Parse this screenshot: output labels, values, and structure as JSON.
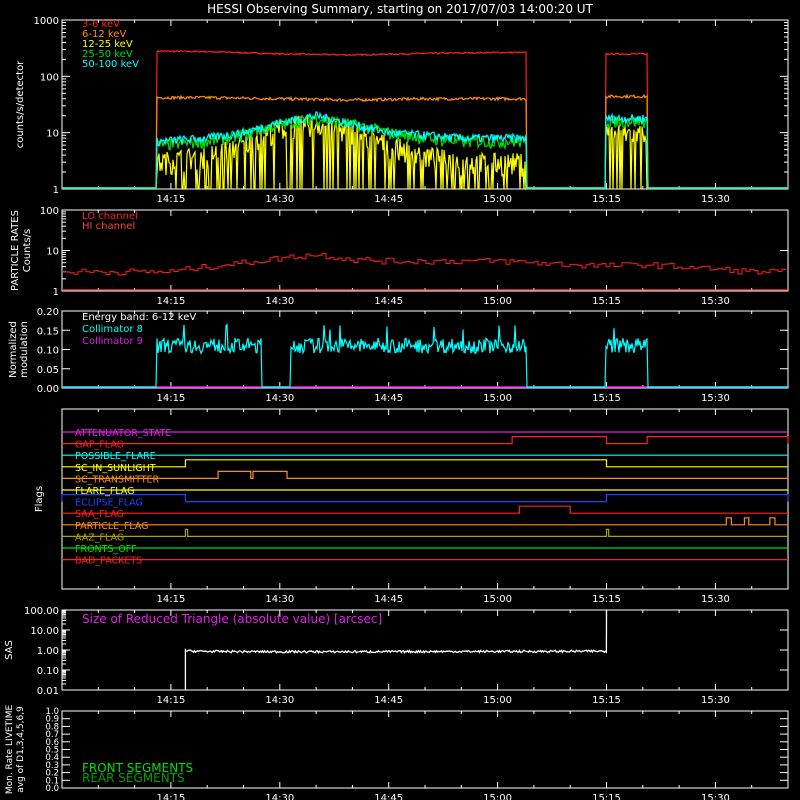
{
  "title": "HESSI Observing Summary, starting on 2017/07/03 14:00:20 UT",
  "time_axis": {
    "ticks": [
      "14:15",
      "14:30",
      "14:45",
      "15:00",
      "15:15",
      "15:30"
    ],
    "tick_minutes": [
      15,
      30,
      45,
      60,
      75,
      90
    ]
  },
  "colors": {
    "red": "#ff2020",
    "orange": "#ff8c1a",
    "yellow": "#ffff00",
    "green": "#00e000",
    "cyan": "#00ffff",
    "magenta": "#e020e0",
    "blue": "#2040ff",
    "olive": "#b0a000",
    "darkgreen": "#00a000",
    "salmon": "#ff4040",
    "white": "#ffffff"
  },
  "chart_data": [
    {
      "name": "count-rates",
      "type": "line",
      "ylabel": "counts/s/detector",
      "yscale": "log",
      "ylim": [
        1,
        1000
      ],
      "ytick_labels": [
        "1",
        "10",
        "100",
        "1000"
      ],
      "xlim_minutes": [
        0,
        100
      ],
      "data_intervals_minutes": [
        [
          13.0,
          64.0
        ],
        [
          74.8,
          80.6
        ]
      ],
      "series": [
        {
          "name": "3-6 keV",
          "color": "red",
          "x": [
            13,
            20,
            30,
            40,
            50,
            60,
            64,
            74.8,
            80.6
          ],
          "y": [
            280,
            275,
            250,
            240,
            255,
            265,
            265,
            250,
            250
          ]
        },
        {
          "name": "6-12 keV",
          "color": "orange",
          "x": [
            13,
            20,
            30,
            40,
            50,
            60,
            64,
            74.8,
            80.6
          ],
          "y": [
            42,
            42,
            40,
            38,
            40,
            40,
            40,
            44,
            44
          ]
        },
        {
          "name": "12-25 keV",
          "color": "yellow",
          "x": [
            13,
            20,
            25,
            30,
            35,
            40,
            45,
            50,
            55,
            60,
            64,
            74.8,
            80.6
          ],
          "y": [
            3,
            4,
            6,
            12,
            15,
            10,
            6,
            4,
            3,
            3,
            3,
            10,
            10
          ]
        },
        {
          "name": "25-50 keV",
          "color": "green",
          "x": [
            13,
            20,
            25,
            30,
            35,
            40,
            45,
            50,
            55,
            60,
            64,
            74.8,
            80.6
          ],
          "y": [
            6,
            7,
            9,
            14,
            18,
            14,
            10,
            8,
            7,
            7,
            7,
            16,
            16
          ]
        },
        {
          "name": "50-100 keV",
          "color": "cyan",
          "x": [
            13,
            20,
            25,
            30,
            35,
            40,
            45,
            50,
            55,
            60,
            64,
            74.8,
            80.6
          ],
          "y": [
            7,
            8,
            10,
            15,
            20,
            14,
            10,
            9,
            8,
            8,
            8,
            18,
            18
          ]
        }
      ]
    },
    {
      "name": "particle-rates",
      "type": "line",
      "ylabel": "PARTICLE RATES Counts/s",
      "yscale": "log",
      "ylim": [
        1,
        100
      ],
      "ytick_labels": [
        "1",
        "10",
        "100"
      ],
      "series": [
        {
          "name": "LO channel",
          "color": "red",
          "x": [
            0,
            5,
            10,
            15,
            20,
            25,
            30,
            35,
            40,
            45,
            50,
            55,
            60,
            65,
            70,
            75,
            80,
            85,
            90,
            95,
            100
          ],
          "y": [
            3,
            3,
            3,
            3,
            4,
            5,
            6.5,
            8,
            6,
            5.5,
            5.5,
            5.5,
            5.5,
            5,
            4.5,
            4.2,
            4.5,
            4,
            3.5,
            3,
            3
          ]
        },
        {
          "name": "HI channel",
          "color": "salmon",
          "x": [
            0,
            100
          ],
          "y": [
            1,
            1
          ]
        }
      ]
    },
    {
      "name": "modulation",
      "type": "line",
      "ylabel": "Normalized modulation",
      "ylim": [
        0,
        0.2
      ],
      "ytick_labels": [
        "0.00",
        "0.05",
        "0.10",
        "0.15",
        "0.20"
      ],
      "annotation": "Energy band: 6-12 keV",
      "data_intervals_minutes": [
        [
          13.0,
          27.5
        ],
        [
          31.5,
          64.0
        ],
        [
          74.8,
          80.6
        ]
      ],
      "series": [
        {
          "name": "Collimator 8",
          "color": "cyan",
          "mean": 0.11
        },
        {
          "name": "Collimator 9",
          "color": "magenta",
          "mean": 0.0
        }
      ]
    },
    {
      "name": "flags",
      "type": "line",
      "ylabel": "Flags",
      "series": [
        {
          "name": "ATTENUATOR_STATE",
          "color": "magenta",
          "high": []
        },
        {
          "name": "GAP_FLAG",
          "color": "red",
          "high": [
            [
              62,
              75
            ],
            [
              80.6,
              100
            ]
          ]
        },
        {
          "name": "POSSIBLE_FLARE",
          "color": "cyan",
          "high": []
        },
        {
          "name": "SC_IN_SUNLIGHT",
          "color": "yellow",
          "high": [
            [
              17,
              75
            ]
          ]
        },
        {
          "name": "SC_TRANSMITTER",
          "color": "orange",
          "high": [
            [
              21.5,
              26
            ],
            [
              26.3,
              31
            ]
          ]
        },
        {
          "name": "FLARE_FLAG",
          "color": "yellow",
          "high": []
        },
        {
          "name": "ECLIPSE_FLAG",
          "color": "blue",
          "high": [
            [
              0,
              17
            ],
            [
              75,
              100
            ]
          ]
        },
        {
          "name": "SAA_FLAG",
          "color": "red",
          "high": [
            [
              63,
              70
            ]
          ]
        },
        {
          "name": "PARTICLE_FLAG",
          "color": "orange",
          "high": [
            [
              91.5,
              92.2
            ],
            [
              94,
              94.6
            ],
            [
              97.5,
              98.2
            ]
          ]
        },
        {
          "name": "AAZ_FLAG",
          "color": "olive",
          "high": [
            [
              17,
              17.3
            ],
            [
              75,
              75.3
            ]
          ]
        },
        {
          "name": "FRONTS_OFF",
          "color": "green",
          "high": []
        },
        {
          "name": "BAD_PACKETS",
          "color": "red",
          "high": []
        }
      ]
    },
    {
      "name": "sas",
      "type": "line",
      "ylabel": "SAS",
      "yscale": "log",
      "ylim": [
        0.01,
        100
      ],
      "ytick_labels": [
        "0.01",
        "0.10",
        "1.00",
        "10.00",
        "100.00"
      ],
      "annotation": "Size of Reduced Triangle (absolute value) [arcsec]",
      "data_interval_minutes": [
        17.0,
        75.0
      ],
      "series": [
        {
          "name": "",
          "color": "white",
          "x": [
            17,
            20,
            30,
            40,
            50,
            60,
            70,
            75
          ],
          "y": [
            0.9,
            0.85,
            0.82,
            0.82,
            0.84,
            0.85,
            0.86,
            0.88
          ]
        }
      ]
    },
    {
      "name": "livetime",
      "type": "line",
      "ylabel": "Mon. Rate LIVETIME avg of D1,3,4,5,6,9",
      "ylim": [
        0,
        1.0
      ],
      "ytick_labels": [
        "0.0",
        "0.1",
        "0.2",
        "0.3",
        "0.4",
        "0.5",
        "0.6",
        "0.7",
        "0.8",
        "0.9",
        "1.0"
      ],
      "series": [
        {
          "name": "FRONT SEGMENTS",
          "color": "green"
        },
        {
          "name": "REAR SEGMENTS",
          "color": "darkgreen"
        }
      ]
    }
  ]
}
